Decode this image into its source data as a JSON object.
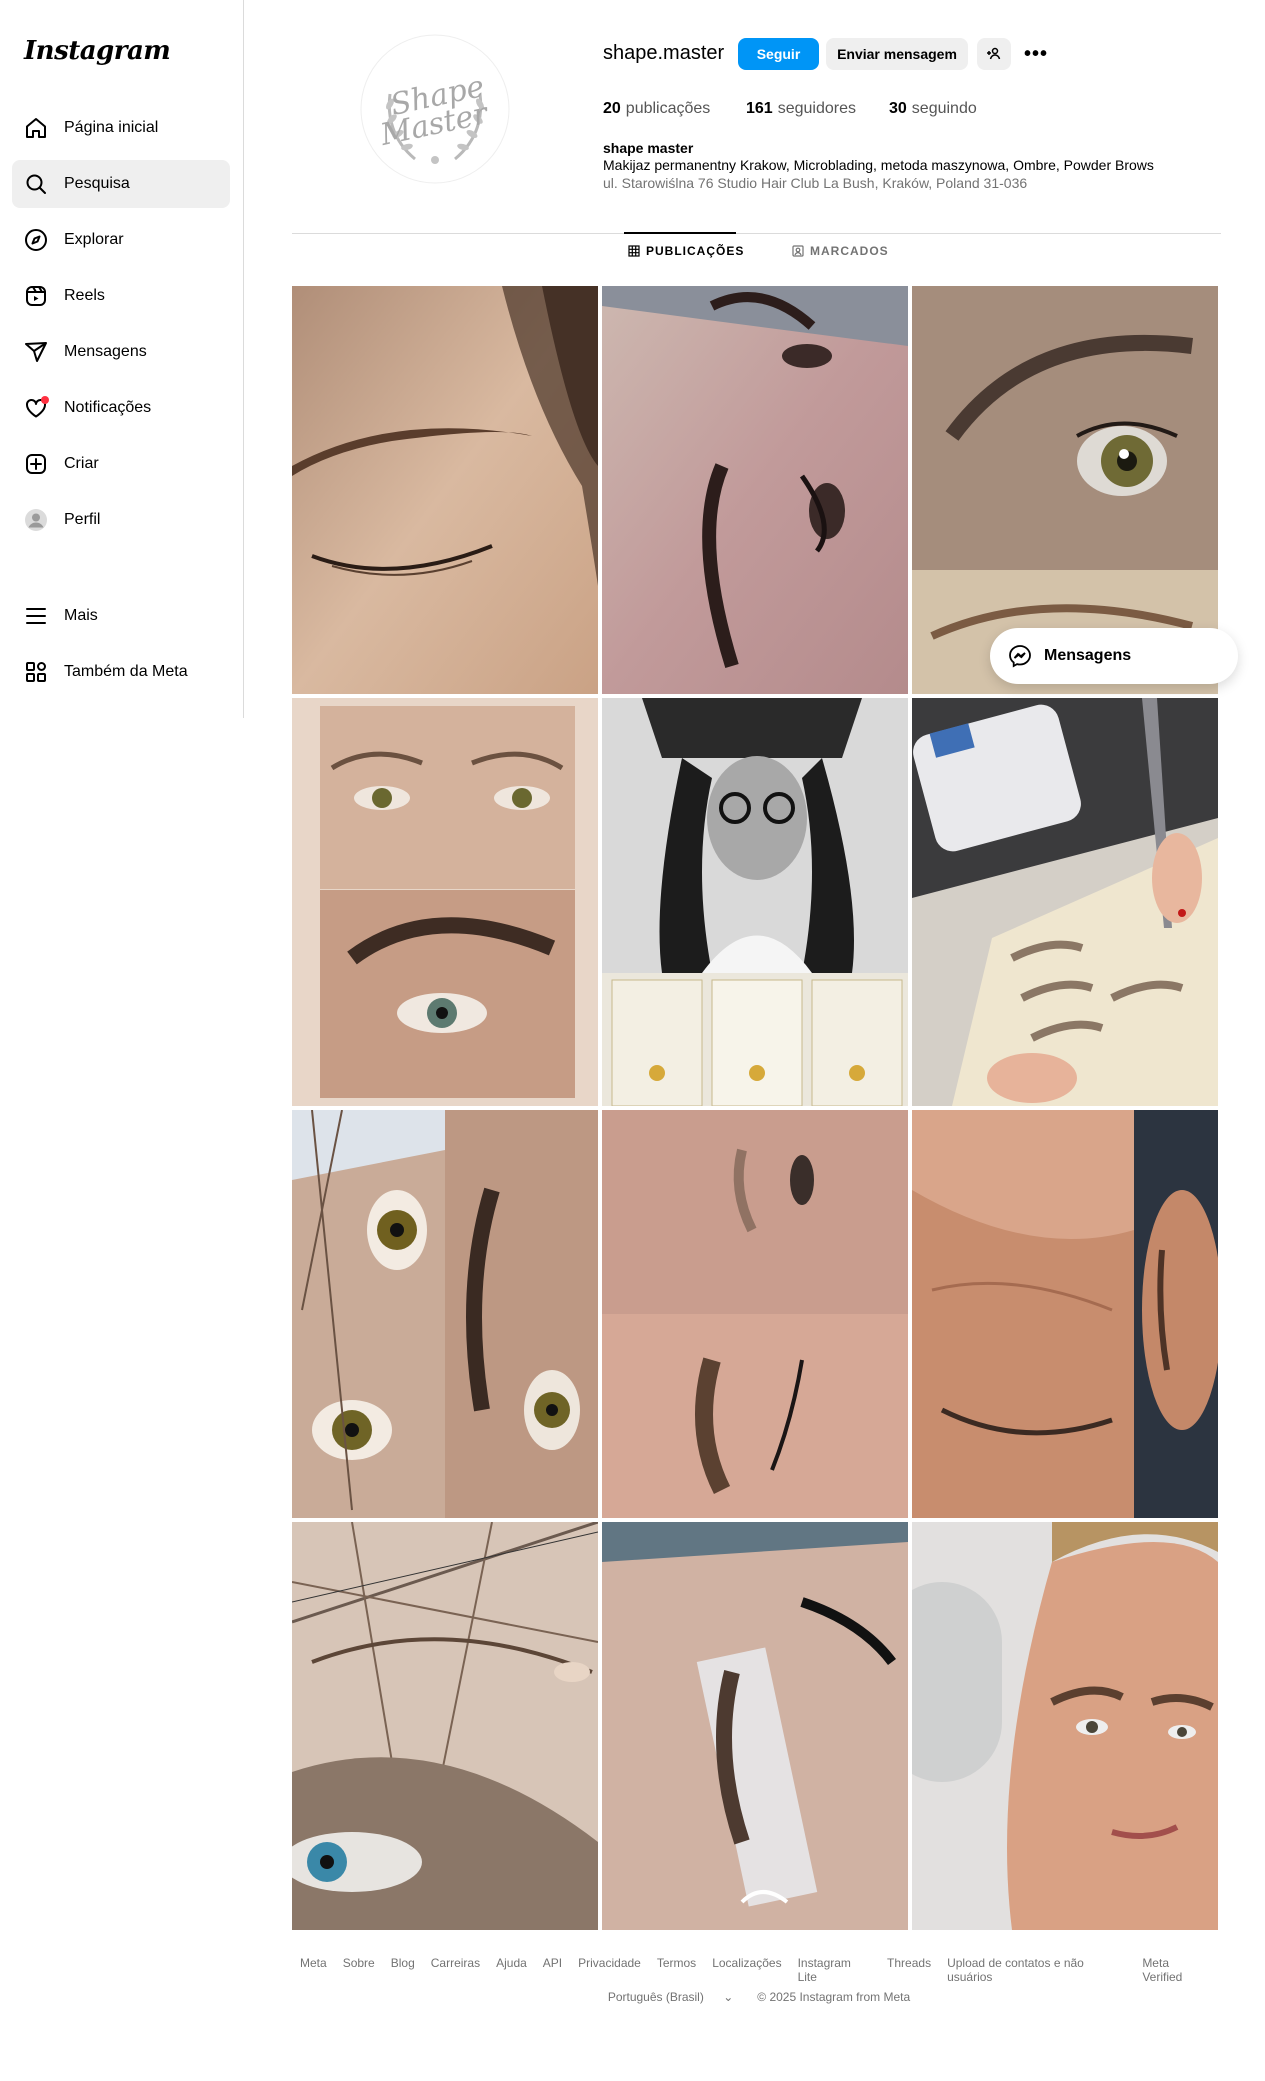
{
  "sidebar": {
    "logo": "Instagram",
    "items": [
      {
        "label": "Página inicial",
        "icon": "home-icon"
      },
      {
        "label": "Pesquisa",
        "icon": "search-icon"
      },
      {
        "label": "Explorar",
        "icon": "compass-icon"
      },
      {
        "label": "Reels",
        "icon": "reels-icon"
      },
      {
        "label": "Mensagens",
        "icon": "send-icon"
      },
      {
        "label": "Notificações",
        "icon": "heart-icon"
      },
      {
        "label": "Criar",
        "icon": "plus-square-icon"
      },
      {
        "label": "Perfil",
        "icon": "avatar-icon"
      },
      {
        "label": "Mais",
        "icon": "menu-icon"
      },
      {
        "label": "Também da Meta",
        "icon": "meta-apps-icon"
      }
    ]
  },
  "profile": {
    "username": "shape.master",
    "follow_label": "Seguir",
    "message_label": "Enviar mensagem",
    "avatar_text_1": "Shape",
    "avatar_text_2": "Master",
    "posts_count": "20",
    "posts_label": "publicações",
    "followers_count": "161",
    "followers_label": "seguidores",
    "following_count": "30",
    "following_label": "seguindo",
    "bio_name": "shape master",
    "bio_text": "Makijaz permanentny Krakow, Microblading, metoda maszynowa, Ombre, Powder Brows",
    "bio_address": "ul. Starowiślna 76 Studio Hair Club La Bush, Kraków, Poland 31-036"
  },
  "tabs": {
    "posts": "PUBLICAÇÕES",
    "tagged": "MARCADOS"
  },
  "posts": [
    {
      "name": "post-eyebrow-closed-eye"
    },
    {
      "name": "post-eyebrow-two-views"
    },
    {
      "name": "post-eyebrow-green-eye"
    },
    {
      "name": "post-before-after-eyes"
    },
    {
      "name": "post-portrait-certificates"
    },
    {
      "name": "post-microblading-practice"
    },
    {
      "name": "post-eyebrow-collage"
    },
    {
      "name": "post-eyebrow-before-after"
    },
    {
      "name": "post-eyebrow-mature-skin"
    },
    {
      "name": "post-eyebrow-mapping"
    },
    {
      "name": "post-eyebrow-ruler"
    },
    {
      "name": "post-client-portrait"
    }
  ],
  "floating": {
    "messages_label": "Mensagens"
  },
  "footer": {
    "links": [
      "Meta",
      "Sobre",
      "Blog",
      "Carreiras",
      "Ajuda",
      "API",
      "Privacidade",
      "Termos",
      "Localizações",
      "Instagram Lite",
      "Threads",
      "Upload de contatos e não usuários",
      "Meta Verified"
    ],
    "language": "Português (Brasil)",
    "copyright": "© 2025 Instagram from Meta"
  }
}
